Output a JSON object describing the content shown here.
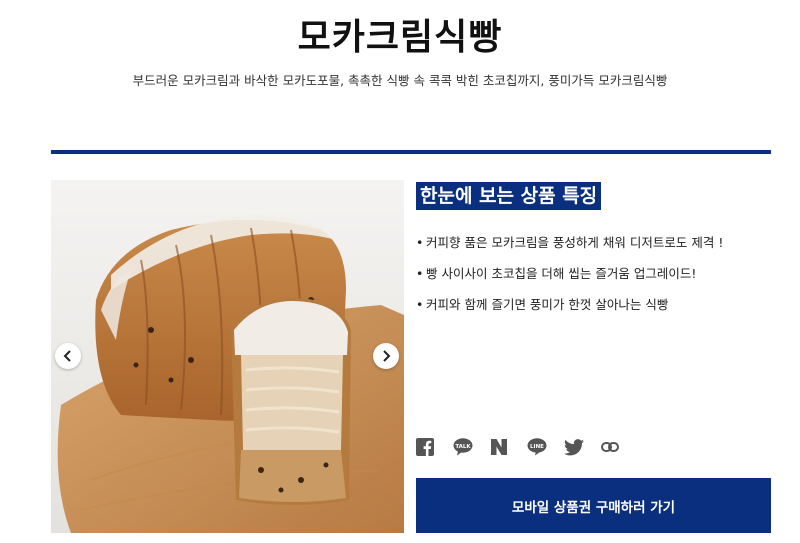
{
  "product": {
    "title": "모카크림식빵",
    "subtitle": "부드러운 모카크림과 바삭한 모카도포물, 촉촉한 식빵 속 콕콕 박힌 초코칩까지, 풍미가득 모카크림식빵"
  },
  "features": {
    "heading": "한눈에 보는 상품 특징",
    "items": [
      "커피향 품은 모카크림을 풍성하게 채워 디저트로도 제격 !",
      "빵 사이사이 초코칩을 더해 씹는 즐거움 업그레이드!",
      "커피와 함께 즐기면 풍미가 한껏 살아나는 식빵"
    ]
  },
  "share": {
    "icons": [
      "facebook-icon",
      "kakaotalk-icon",
      "naver-icon",
      "line-icon",
      "twitter-icon",
      "link-icon"
    ],
    "talk_label": "TALK",
    "line_label": "LINE"
  },
  "buy_button": {
    "label": "모바일 상품권 구매하러 가기"
  },
  "colors": {
    "accent": "#0b2f7f",
    "icon_gray": "#555555"
  }
}
